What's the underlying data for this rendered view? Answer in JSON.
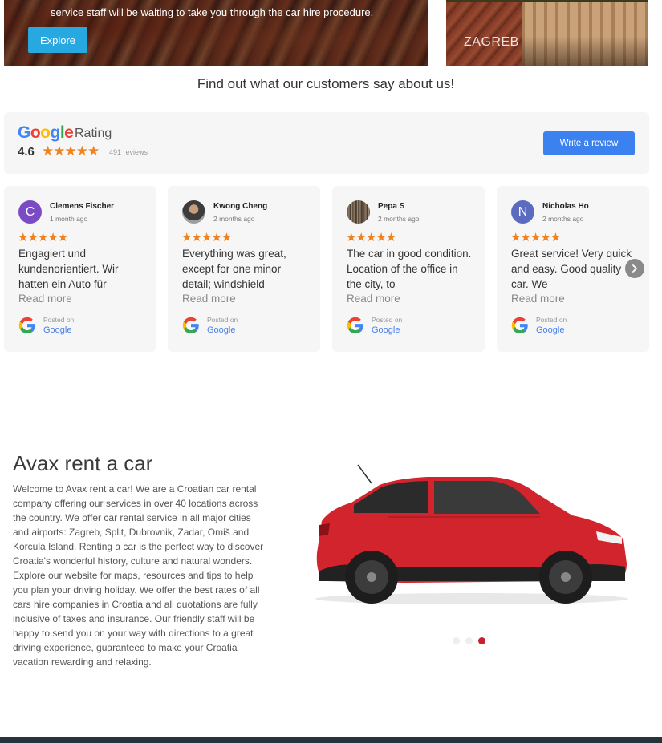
{
  "hero": {
    "text": "service staff will be waiting to take you through the car hire procedure.",
    "explore_label": "Explore",
    "city_name": "ZAGREB"
  },
  "reviews_section": {
    "title": "Find out what our customers say about us!",
    "google_word": [
      "G",
      "o",
      "o",
      "g",
      "l",
      "e"
    ],
    "google_colors": [
      "#4285F4",
      "#EA4335",
      "#FBBC05",
      "#4285F4",
      "#34A853",
      "#EA4335"
    ],
    "rating_label": "Rating",
    "score": "4.6",
    "stars": "★★★★★",
    "count": "491 reviews",
    "write_review_label": "Write a review",
    "next_icon": "chevron-right-icon"
  },
  "reviews": [
    {
      "name": "Clemens Fischer",
      "when": "1 month ago",
      "stars": "★★★★★",
      "text": "Engagiert und kundenorientiert. Wir hatten ein Auto für",
      "read_more": "Read more",
      "posted": "Posted on",
      "source": "Google",
      "avatar_letter": "C",
      "avatar_color": "#7a4bc4"
    },
    {
      "name": "Kwong Cheng",
      "when": "2 months ago",
      "stars": "★★★★★",
      "text": "Everything was great, except for one minor detail; windshield",
      "read_more": "Read more",
      "posted": "Posted on",
      "source": "Google",
      "avatar_letter": "",
      "avatar_color": ""
    },
    {
      "name": "Pepa S",
      "when": "2 months ago",
      "stars": "★★★★★",
      "text": "The car in good condition. Location of the office in the city, to",
      "read_more": "Read more",
      "posted": "Posted on",
      "source": "Google",
      "avatar_letter": "",
      "avatar_color": ""
    },
    {
      "name": "Nicholas Ho",
      "when": "2 months ago",
      "stars": "★★★★★",
      "text": "Great service! Very quick and easy. Good quality car. We",
      "read_more": "Read more",
      "posted": "Posted on",
      "source": "Google",
      "avatar_letter": "N",
      "avatar_color": "#5c6bc0"
    }
  ],
  "about": {
    "title": "Avax rent a car",
    "text": "Welcome to Avax rent a car! We are a Croatian car rental company offering our services in over 40 locations across the country. We offer car rental service in all major cities and airports: Zagreb, Split, Dubrovnik, Zadar, Omiš and Korcula Island. Renting a car is the perfect way to discover Croatia's wonderful history, culture and natural wonders. Explore our website for maps, resources and tips to help you plan your driving holiday. We offer the best rates of all cars hire companies in Croatia and all quotations are fully inclusive of taxes and insurance. Our friendly staff will be happy to send you on your way with directions to a great driving experience, guaranteed to make your Croatia vacation rewarding and relaxing.",
    "slider_active_index": 2,
    "slider_count": 3
  },
  "colors": {
    "accent_blue": "#3b82f0",
    "explore_blue": "#27a8e0",
    "star_orange": "#f0821e",
    "dot_active": "#c8202f",
    "car_red": "#d2242c"
  }
}
